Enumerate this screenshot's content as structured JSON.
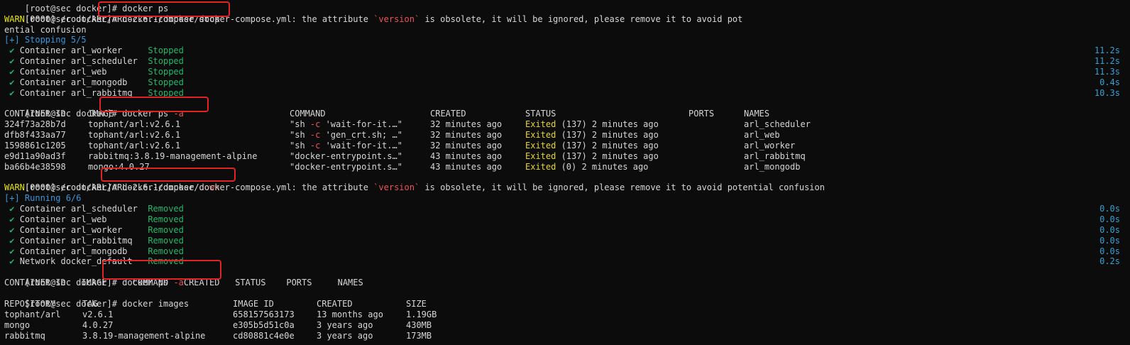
{
  "prompt": "[root@sec docker]#",
  "warn_prefix": "WARN",
  "warn_code": "[0000] /root/ARL/ARL-2.6.1/docker/docker-compose.yml: the attribute ",
  "version_word": "`version`",
  "warn_tail_1": " is obsolete, it will be ignored, please remove it to avoid pot",
  "warn_wrap_1": "ential confusion",
  "warn_tail_2": " is obsolete, it will be ignored, please remove it to avoid potential confusion",
  "cmd_stop": " docker-compose stop",
  "cmd_ps_base": " docker ps ",
  "cmd_ps_flag": "-a",
  "cmd_down_base": " docker-compose ",
  "cmd_down_word": "down",
  "cmd_images": " docker images",
  "check": " ✔ ",
  "stopping_header": "[+] Stopping 5/5",
  "stopping": [
    {
      "name": "Container arl_worker     ",
      "status": "Stopped",
      "time": "11.2s"
    },
    {
      "name": "Container arl_scheduler  ",
      "status": "Stopped",
      "time": "11.2s"
    },
    {
      "name": "Container arl_web        ",
      "status": "Stopped",
      "time": "11.3s"
    },
    {
      "name": "Container arl_mongodb    ",
      "status": "Stopped",
      "time": "0.4s"
    },
    {
      "name": "Container arl_rabbitmq   ",
      "status": "Stopped",
      "time": "10.3s"
    }
  ],
  "ps_headers": {
    "id": "CONTAINER ID",
    "image": "IMAGE",
    "command": "COMMAND",
    "created": "CREATED",
    "status": "STATUS",
    "ports": "PORTS",
    "names": "NAMES"
  },
  "ps_rows": [
    {
      "id": "324f73a28b7d",
      "image": "tophant/arl:v2.6.1",
      "cmd_a": "\"sh ",
      "cmd_flag": "-c",
      "cmd_b": " 'wait-for-it.…\"",
      "created": "32 minutes ago",
      "exited": "Exited",
      "status_rest": " (137) 2 minutes ago",
      "names": "arl_scheduler"
    },
    {
      "id": "dfb8f433aa77",
      "image": "tophant/arl:v2.6.1",
      "cmd_a": "\"sh ",
      "cmd_flag": "-c",
      "cmd_b": " 'gen_crt.sh; …\"",
      "created": "32 minutes ago",
      "exited": "Exited",
      "status_rest": " (137) 2 minutes ago",
      "names": "arl_web"
    },
    {
      "id": "1598861c1205",
      "image": "tophant/arl:v2.6.1",
      "cmd_a": "\"sh ",
      "cmd_flag": "-c",
      "cmd_b": " 'wait-for-it.…\"",
      "created": "32 minutes ago",
      "exited": "Exited",
      "status_rest": " (137) 2 minutes ago",
      "names": "arl_worker"
    },
    {
      "id": "e9d11a90ad3f",
      "image": "rabbitmq:3.8.19-management-alpine",
      "cmd_a": "\"docker-entrypoint.s…\"",
      "cmd_flag": "",
      "cmd_b": "",
      "created": "43 minutes ago",
      "exited": "Exited",
      "status_rest": " (137) 2 minutes ago",
      "names": "arl_rabbitmq"
    },
    {
      "id": "ba66b4e38598",
      "image": "mongo:4.0.27",
      "cmd_a": "\"docker-entrypoint.s…\"",
      "cmd_flag": "",
      "cmd_b": "",
      "created": "43 minutes ago",
      "exited": "Exited",
      "status_rest": " (0) 2 minutes ago",
      "names": "arl_mongodb"
    }
  ],
  "running_header": "[+] Running 6/6",
  "removing": [
    {
      "name": "Container arl_scheduler  ",
      "status": "Removed",
      "time": "0.0s"
    },
    {
      "name": "Container arl_web        ",
      "status": "Removed",
      "time": "0.0s"
    },
    {
      "name": "Container arl_worker     ",
      "status": "Removed",
      "time": "0.0s"
    },
    {
      "name": "Container arl_rabbitmq   ",
      "status": "Removed",
      "time": "0.0s"
    },
    {
      "name": "Container arl_mongodb    ",
      "status": "Removed",
      "time": "0.0s"
    },
    {
      "name": "Network docker_default   ",
      "status": "Removed",
      "time": "0.2s"
    }
  ],
  "ps_empty_header": "CONTAINER ID   IMAGE     COMMAND   CREATED   STATUS    PORTS     NAMES",
  "img_headers": {
    "repo": "REPOSITORY",
    "tag": "TAG",
    "id": "IMAGE ID",
    "created": "CREATED",
    "size": "SIZE"
  },
  "images": [
    {
      "repo": "tophant/arl",
      "tag": "v2.6.1",
      "id": "658157563173",
      "created": "13 months ago",
      "size": "1.19GB"
    },
    {
      "repo": "mongo",
      "tag": "4.0.27",
      "id": "e305b5d51c0a",
      "created": "3 years ago",
      "size": "430MB"
    },
    {
      "repo": "rabbitmq",
      "tag": "3.8.19-management-alpine",
      "id": "cd80881c4e0e",
      "created": "3 years ago",
      "size": "173MB"
    }
  ],
  "colors": {
    "green": "#23b86b",
    "blue": "#3a96dd",
    "warn": "#e5e510",
    "exited": "#e5d52a",
    "highlight": "#e02323"
  }
}
